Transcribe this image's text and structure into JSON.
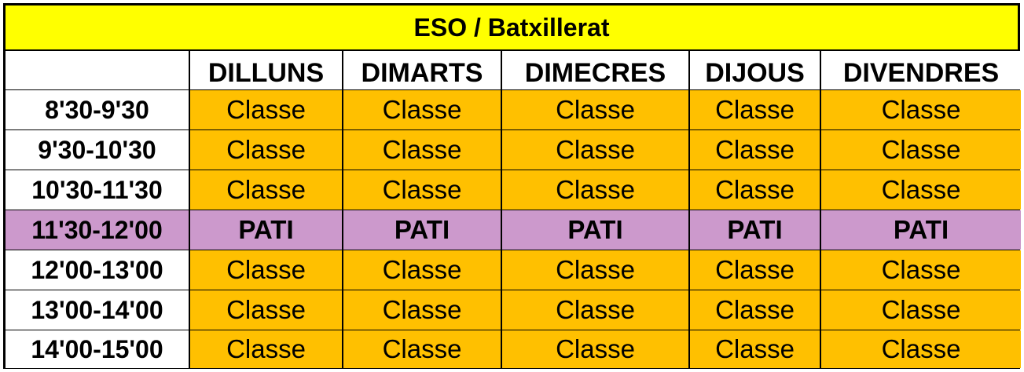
{
  "title": "ESO / Batxillerat",
  "colors": {
    "title_bg": "#ffff00",
    "class_bg": "#ffc000",
    "break_bg": "#cc99cc",
    "border": "#000000"
  },
  "days": [
    "DILLUNS",
    "DIMARTS",
    "DIMECRES",
    "DIJOUS",
    "DIVENDRES"
  ],
  "rows": [
    {
      "time": "8'30-9'30",
      "type": "class",
      "cells": [
        "Classe",
        "Classe",
        "Classe",
        "Classe",
        "Classe"
      ]
    },
    {
      "time": "9'30-10'30",
      "type": "class",
      "cells": [
        "Classe",
        "Classe",
        "Classe",
        "Classe",
        "Classe"
      ]
    },
    {
      "time": "10'30-11'30",
      "type": "class",
      "cells": [
        "Classe",
        "Classe",
        "Classe",
        "Classe",
        "Classe"
      ]
    },
    {
      "time": "11'30-12'00",
      "type": "break",
      "cells": [
        "PATI",
        "PATI",
        "PATI",
        "PATI",
        "PATI"
      ]
    },
    {
      "time": "12'00-13'00",
      "type": "class",
      "cells": [
        "Classe",
        "Classe",
        "Classe",
        "Classe",
        "Classe"
      ]
    },
    {
      "time": "13'00-14'00",
      "type": "class",
      "cells": [
        "Classe",
        "Classe",
        "Classe",
        "Classe",
        "Classe"
      ]
    },
    {
      "time": "14'00-15'00",
      "type": "class",
      "cells": [
        "Classe",
        "Classe",
        "Classe",
        "Classe",
        "Classe"
      ]
    }
  ]
}
